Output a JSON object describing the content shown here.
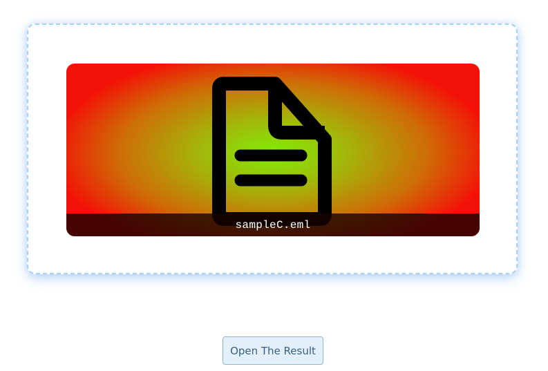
{
  "preview": {
    "file_name": "sampleC.eml",
    "icon": "document-icon"
  },
  "actions": {
    "open_result_label": "Open The Result"
  },
  "colors": {
    "drop_zone_border": "#a6d1f2",
    "gradient_center": "#80ee08",
    "gradient_edge": "#f31207",
    "button_background": "#e3eff9",
    "button_text": "#3b6283"
  }
}
